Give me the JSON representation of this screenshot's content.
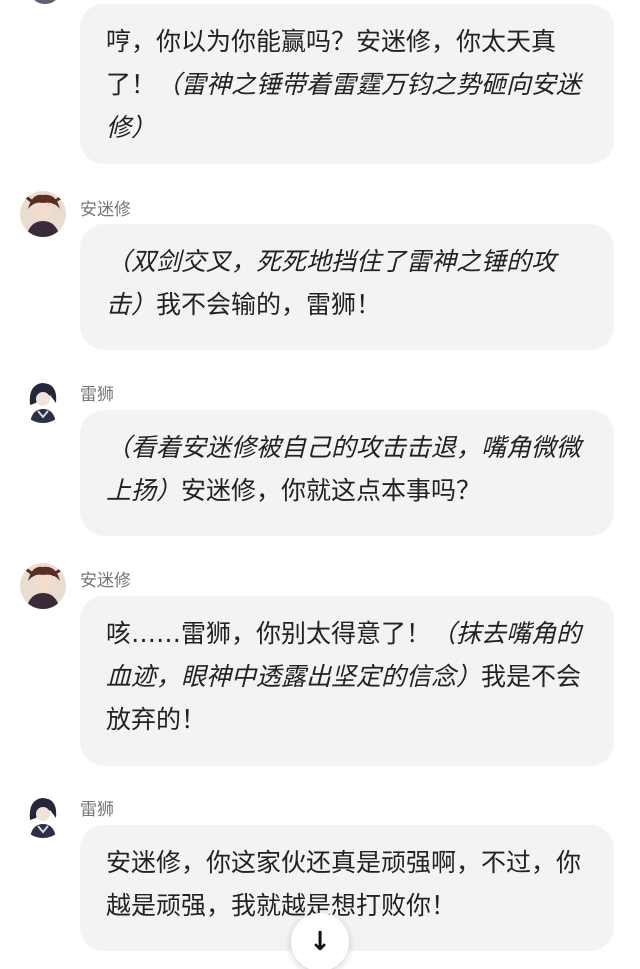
{
  "messages": [
    {
      "sender": "",
      "avatar_icon": "lei-shi-avatar-icon",
      "parts": [
        {
          "text": "哼，你以为你能赢吗？安迷修，你太天真了！",
          "italic": false
        },
        {
          "text": "（雷神之锤带着雷霆万钧之势砸向安迷修）",
          "italic": true
        }
      ]
    },
    {
      "sender": "安迷修",
      "avatar_icon": "an-mi-xiu-avatar-icon",
      "parts": [
        {
          "text": "（双剑交叉，死死地挡住了雷神之锤的攻击）",
          "italic": true
        },
        {
          "text": "我不会输的，雷狮！",
          "italic": false
        }
      ]
    },
    {
      "sender": "雷狮",
      "avatar_icon": "lei-shi-avatar-icon",
      "parts": [
        {
          "text": "（看着安迷修被自己的攻击击退，嘴角微微上扬）",
          "italic": true
        },
        {
          "text": "安迷修，你就这点本事吗？",
          "italic": false
        }
      ]
    },
    {
      "sender": "安迷修",
      "avatar_icon": "an-mi-xiu-avatar-icon",
      "parts": [
        {
          "text": "咳……雷狮，你别太得意了！",
          "italic": false
        },
        {
          "text": "（抹去嘴角的血迹，眼神中透露出坚定的信念）",
          "italic": true
        },
        {
          "text": "我是不会放弃的！",
          "italic": false
        }
      ]
    },
    {
      "sender": "雷狮",
      "avatar_icon": "lei-shi-avatar-icon",
      "parts": [
        {
          "text": "安迷修，你这家伙还真是顽强啊，不过，你越是顽强，我就越是想打败你！",
          "italic": false
        }
      ]
    }
  ],
  "scroll_button": {
    "icon": "arrow-down-icon",
    "glyph": "↓"
  },
  "colors": {
    "bubble_bg": "#f3f3f4",
    "text": "#222222",
    "sender_text": "#777777",
    "background": "#ffffff"
  }
}
